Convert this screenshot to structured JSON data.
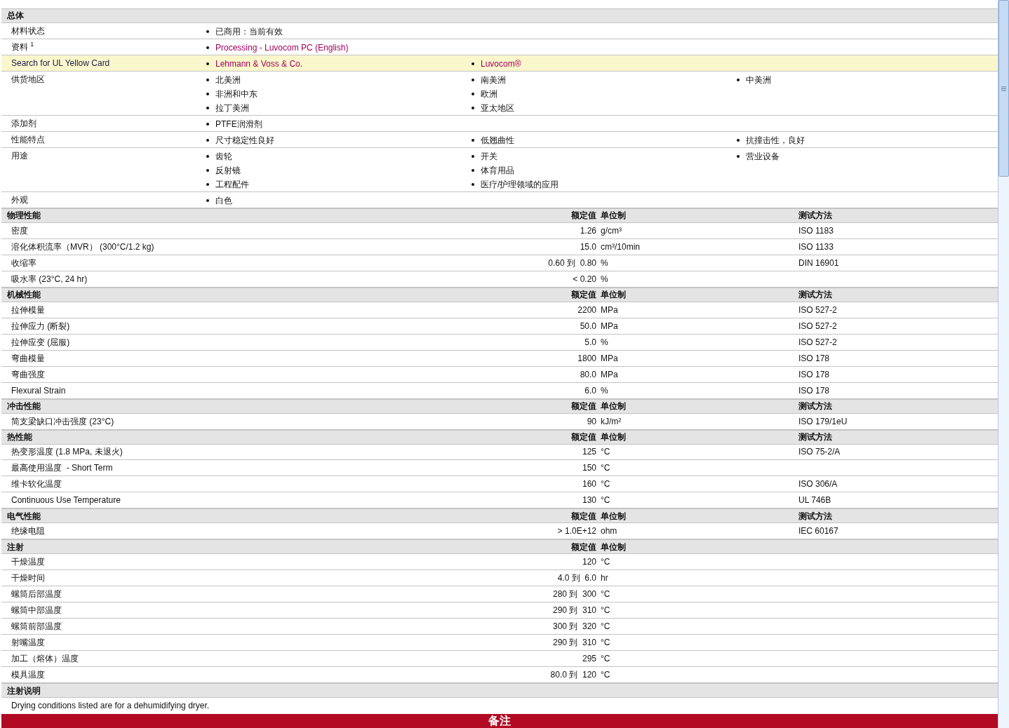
{
  "general": {
    "title": "总体",
    "rows": [
      {
        "label": "材料状态",
        "highlighted": false,
        "columns": [
          [
            {
              "text": "已商用：当前有效",
              "link": false
            }
          ]
        ]
      },
      {
        "label": "资料 $^{1}$",
        "highlighted": false,
        "columns": [
          [
            {
              "text": "Processing - Luvocom PC (English)",
              "link": true
            }
          ]
        ]
      },
      {
        "label": "Search for UL Yellow Card",
        "highlighted": true,
        "columns": [
          [
            {
              "text": "Lehmann & Voss & Co.",
              "link": true
            }
          ],
          [
            {
              "text": "Luvocom®",
              "link": true
            }
          ]
        ]
      },
      {
        "label": "供货地区",
        "highlighted": false,
        "columns": [
          [
            {
              "text": "北美洲",
              "link": false
            },
            {
              "text": "非洲和中东",
              "link": false
            },
            {
              "text": "拉丁美洲",
              "link": false
            }
          ],
          [
            {
              "text": "南美洲",
              "link": false
            },
            {
              "text": "欧洲",
              "link": false
            },
            {
              "text": "亚太地区",
              "link": false
            }
          ],
          [
            {
              "text": "中美洲",
              "link": false
            }
          ]
        ]
      },
      {
        "label": "添加剂",
        "highlighted": false,
        "columns": [
          [
            {
              "text": "PTFE润滑剂",
              "link": false
            }
          ]
        ]
      },
      {
        "label": "性能特点",
        "highlighted": false,
        "columns": [
          [
            {
              "text": "尺寸稳定性良好",
              "link": false
            }
          ],
          [
            {
              "text": "低翘曲性",
              "link": false
            }
          ],
          [
            {
              "text": "抗撞击性，良好",
              "link": false
            }
          ]
        ]
      },
      {
        "label": "用途",
        "highlighted": false,
        "columns": [
          [
            {
              "text": "齿轮",
              "link": false
            },
            {
              "text": "反射镜",
              "link": false
            },
            {
              "text": "工程配件",
              "link": false
            }
          ],
          [
            {
              "text": "开关",
              "link": false
            },
            {
              "text": "体育用品",
              "link": false
            },
            {
              "text": "医疗/护理领域的应用",
              "link": false
            }
          ],
          [
            {
              "text": "营业设备",
              "link": false
            }
          ]
        ]
      },
      {
        "label": "外观",
        "highlighted": false,
        "columns": [
          [
            {
              "text": "白色",
              "link": false
            }
          ]
        ]
      }
    ]
  },
  "sections": [
    {
      "title": "物理性能",
      "value_header": "额定值",
      "unit_header": "单位制",
      "method_header": "测试方法",
      "rows": [
        {
          "label": "密度",
          "value": "1.26",
          "unit": "g/cm³",
          "method": "ISO 1183"
        },
        {
          "label": "溶化体积流率（MVR） (300°C/1.2 kg)",
          "value": "15.0",
          "unit": "cm³/10min",
          "method": "ISO 1133"
        },
        {
          "label": "收缩率",
          "value": "0.60 到  0.80",
          "unit": "%",
          "method": "DIN 16901"
        },
        {
          "label": "吸水率 (23°C, 24 hr)",
          "value": "< 0.20",
          "unit": "%"
        }
      ]
    },
    {
      "title": "机械性能",
      "value_header": "额定值",
      "unit_header": "单位制",
      "method_header": "测试方法",
      "rows": [
        {
          "label": "拉伸模量",
          "value": "2200",
          "unit": "MPa",
          "method": "ISO 527-2"
        },
        {
          "label": "拉伸应力 (断裂)",
          "value": "50.0",
          "unit": "MPa",
          "method": "ISO 527-2"
        },
        {
          "label": "拉伸应变 (屈服)",
          "value": "5.0",
          "unit": "%",
          "method": "ISO 527-2"
        },
        {
          "label": "弯曲模量",
          "value": "1800",
          "unit": "MPa",
          "method": "ISO 178"
        },
        {
          "label": "弯曲强度",
          "value": "80.0",
          "unit": "MPa",
          "method": "ISO 178"
        },
        {
          "label": "Flexural Strain",
          "value": "6.0",
          "unit": "%",
          "method": "ISO 178"
        }
      ]
    },
    {
      "title": "冲击性能",
      "value_header": "额定值",
      "unit_header": "单位制",
      "method_header": "测试方法",
      "rows": [
        {
          "label": "简支梁缺口冲击强度 (23°C)",
          "value": "90",
          "unit": "kJ/m²",
          "method": "ISO 179/1eU"
        }
      ]
    },
    {
      "title": "热性能",
      "value_header": "额定值",
      "unit_header": "单位制",
      "method_header": "测试方法",
      "rows": [
        {
          "label": "热变形温度 (1.8 MPa, 未退火)",
          "value": "125",
          "unit": "°C",
          "method": "ISO 75-2/A"
        },
        {
          "label": "最高使用温度  - Short Term",
          "value": "150",
          "unit": "°C"
        },
        {
          "label": "维卡软化温度",
          "value": "160",
          "unit": "°C",
          "method": "ISO 306/A"
        },
        {
          "label": "Continuous Use Temperature",
          "value": "130",
          "unit": "°C",
          "method": "UL 746B"
        }
      ]
    },
    {
      "title": "电气性能",
      "value_header": "额定值",
      "unit_header": "单位制",
      "method_header": "测试方法",
      "rows": [
        {
          "label": "绝缘电阻",
          "value": "> 1.0E+12",
          "unit": "ohm",
          "method": "IEC 60167"
        }
      ]
    },
    {
      "title": "注射",
      "value_header": "额定值",
      "unit_header": "单位制",
      "rows": [
        {
          "label": "干燥温度",
          "value": "120",
          "unit": "°C"
        },
        {
          "label": "干燥时间",
          "value": "4.0 到  6.0",
          "unit": "hr"
        },
        {
          "label": "螺筒后部温度",
          "value": "280 到  300",
          "unit": "°C"
        },
        {
          "label": "螺筒中部温度",
          "value": "290 到  310",
          "unit": "°C"
        },
        {
          "label": "螺筒前部温度",
          "value": "300 到  320",
          "unit": "°C"
        },
        {
          "label": "射嘴温度",
          "value": "290 到  310",
          "unit": "°C"
        },
        {
          "label": "加工（熔体）温度",
          "value": "295",
          "unit": "°C"
        },
        {
          "label": "模具温度",
          "value": "80.0 到  120",
          "unit": "°C"
        }
      ]
    }
  ],
  "injection_notes": {
    "title": "注射说明",
    "text": "Drying conditions listed are for a dehumidifying dryer."
  },
  "remarks_banner": "备注"
}
